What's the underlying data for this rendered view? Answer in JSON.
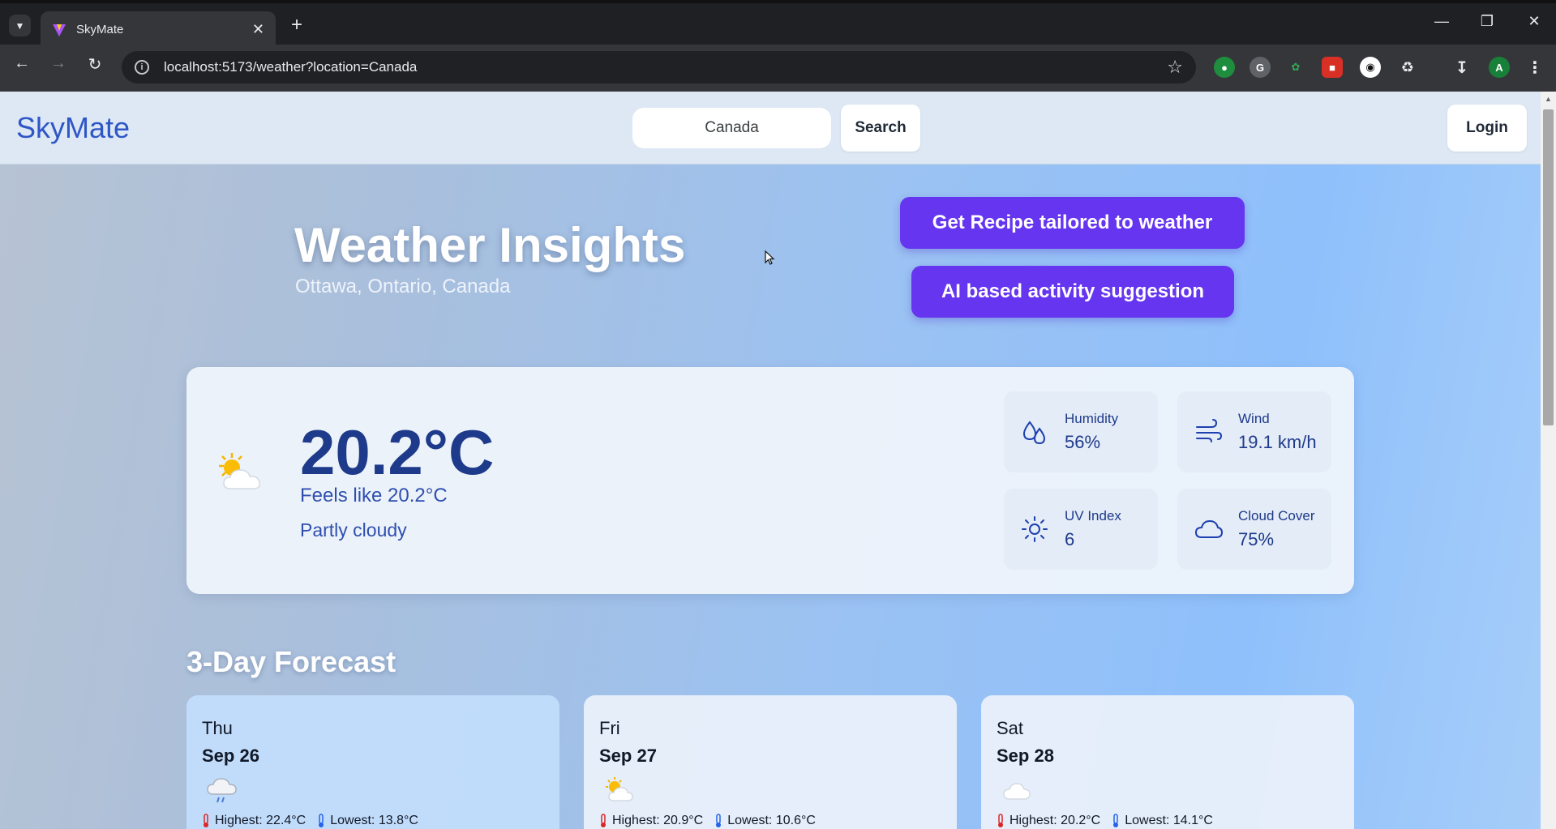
{
  "browser": {
    "tab_title": "SkyMate",
    "url": "localhost:5173/weather?location=Canada",
    "profile_initial": "A"
  },
  "header": {
    "brand": "SkyMate",
    "search_value": "Canada",
    "search_button": "Search",
    "login_button": "Login"
  },
  "hero": {
    "title": "Weather Insights",
    "location": "Ottawa, Ontario, Canada",
    "recipe_button": "Get Recipe tailored to weather",
    "activity_button": "AI based activity suggestion"
  },
  "current": {
    "icon": "partly-cloudy-icon",
    "temperature": "20.2°C",
    "feels_like": "Feels like 20.2°C",
    "condition": "Partly cloudy",
    "stats": {
      "humidity": {
        "label": "Humidity",
        "value": "56%",
        "icon": "humidity-icon"
      },
      "wind": {
        "label": "Wind",
        "value": "19.1 km/h",
        "icon": "wind-icon"
      },
      "uv": {
        "label": "UV Index",
        "value": "6",
        "icon": "sun-icon"
      },
      "cloud": {
        "label": "Cloud Cover",
        "value": "75%",
        "icon": "cloud-icon"
      }
    }
  },
  "forecast": {
    "title": "3-Day Forecast",
    "days": [
      {
        "day": "Thu",
        "date": "Sep 26",
        "icon": "rain-icon",
        "highest": "Highest: 22.4°C",
        "lowest": "Lowest: 13.8°C"
      },
      {
        "day": "Fri",
        "date": "Sep 27",
        "icon": "partly-cloudy-icon",
        "highest": "Highest: 20.9°C",
        "lowest": "Lowest: 10.6°C"
      },
      {
        "day": "Sat",
        "date": "Sep 28",
        "icon": "cloud-icon",
        "highest": "Highest: 20.2°C",
        "lowest": "Lowest: 14.1°C"
      }
    ]
  },
  "colors": {
    "brand": "#2f56c6",
    "accent_button": "#6535f0",
    "text_primary": "#1e3a8a"
  }
}
